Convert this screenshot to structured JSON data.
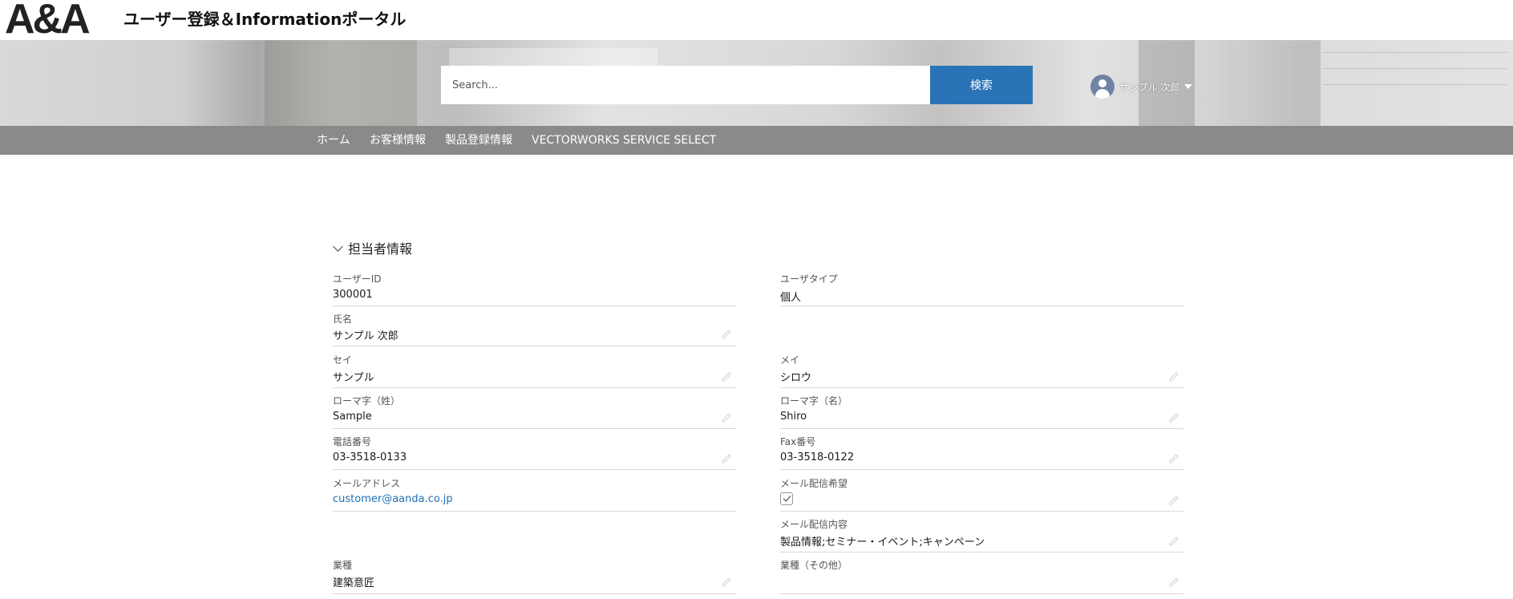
{
  "header": {
    "logo": "A&A",
    "title": "ユーザー登録＆Informationポータル"
  },
  "search": {
    "placeholder": "Search...",
    "button_label": "検索"
  },
  "user_menu": {
    "name": "サンプル 次郎"
  },
  "nav": {
    "items": [
      "ホーム",
      "お客様情報",
      "製品登録情報",
      "VECTORWORKS SERVICE SELECT"
    ]
  },
  "section": {
    "title": "担当者情報"
  },
  "fields": {
    "user_id": {
      "label": "ユーザーID",
      "value": "300001"
    },
    "user_type": {
      "label": "ユーザタイプ",
      "value": "個人"
    },
    "full_name": {
      "label": "氏名",
      "value": "サンプル 次郎"
    },
    "sei": {
      "label": "セイ",
      "value": "サンプル"
    },
    "mei": {
      "label": "メイ",
      "value": "シロウ"
    },
    "romaji_last": {
      "label": "ローマ字（姓）",
      "value": "Sample"
    },
    "romaji_first": {
      "label": "ローマ字（名）",
      "value": "Shiro"
    },
    "phone": {
      "label": "電話番号",
      "value": "03-3518-0133"
    },
    "fax": {
      "label": "Fax番号",
      "value": "03-3518-0122"
    },
    "email": {
      "label": "メールアドレス",
      "value": "customer@aanda.co.jp"
    },
    "mail_opt_in": {
      "label": "メール配信希望",
      "checked": true
    },
    "mail_content": {
      "label": "メール配信内容",
      "value": "製品情報;セミナー・イベント;キャンペーン"
    },
    "industry": {
      "label": "業種",
      "value": "建築意匠"
    },
    "industry_other": {
      "label": "業種（その他）",
      "value": ""
    }
  },
  "colors": {
    "search_button": "#2a73b6",
    "navbar": "#8a8a8a",
    "link": "#1f6fb5",
    "avatar": "#6f83a4"
  }
}
